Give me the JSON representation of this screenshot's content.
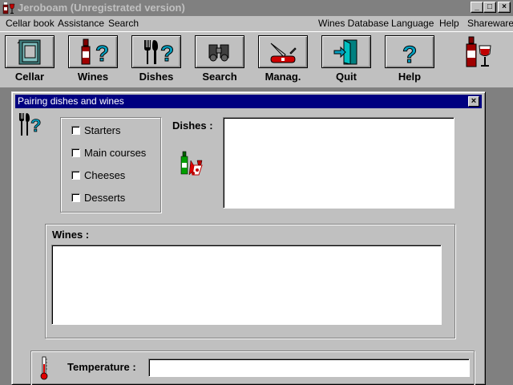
{
  "window": {
    "title": "Jeroboam (Unregistrated version)",
    "minimize": "_",
    "maximize": "□",
    "close": "×"
  },
  "menu": {
    "left": [
      "Cellar book",
      "Assistance",
      "Search"
    ],
    "right": [
      "Wines Database",
      "Language",
      "Help",
      "Shareware"
    ]
  },
  "toolbar": {
    "cellar": "Cellar",
    "wines": "Wines",
    "dishes": "Dishes",
    "search": "Search",
    "manag": "Manag.",
    "quit": "Quit",
    "help": "Help"
  },
  "dialog": {
    "title": "Pairing dishes and wines",
    "close": "×",
    "categories": [
      {
        "label": "Starters",
        "checked": false
      },
      {
        "label": "Main courses",
        "checked": false
      },
      {
        "label": "Cheeses",
        "checked": false
      },
      {
        "label": "Desserts",
        "checked": false
      }
    ],
    "dishes_label": "Dishes :",
    "dishes_value": "",
    "wines_label": "Wines :",
    "wines_value": "",
    "temperature_label": "Temperature :",
    "temperature_value": ""
  }
}
